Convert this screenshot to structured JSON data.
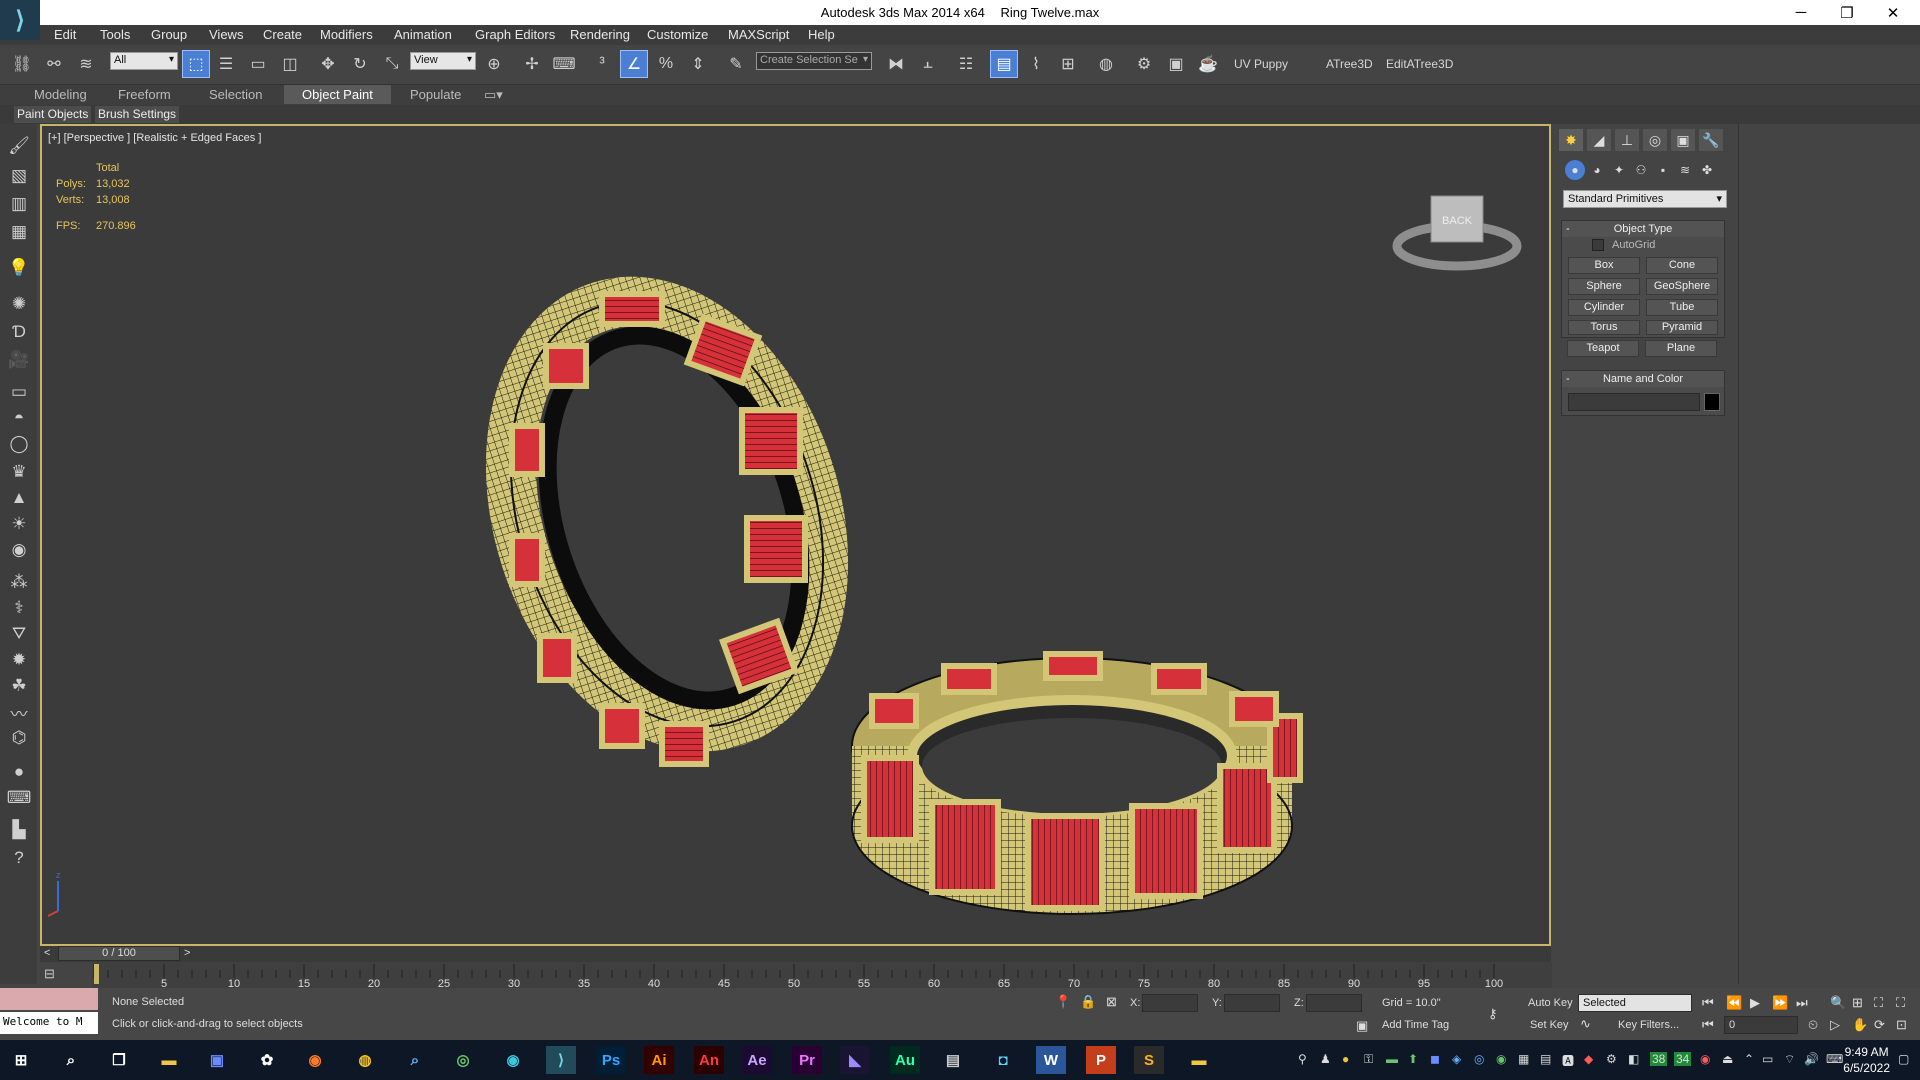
{
  "window": {
    "app_title": "Autodesk 3ds Max  2014 x64",
    "file_name": "Ring Twelve.max"
  },
  "menu": [
    "Edit",
    "Tools",
    "Group",
    "Views",
    "Create",
    "Modifiers",
    "Animation",
    "Graph Editors",
    "Rendering",
    "Customize",
    "MAXScript",
    "Help"
  ],
  "toolbar": {
    "filter_value": "All",
    "ref_coord_value": "View",
    "selection_set_placeholder": "Create Selection Se",
    "uv_puppy": "UV Puppy",
    "atree": "ATree3D",
    "edit_atree": "EditATree3D"
  },
  "ribbon": {
    "tabs": [
      "Modeling",
      "Freeform",
      "Selection",
      "Object Paint",
      "Populate"
    ],
    "active_tab": "Object Paint",
    "sub_tabs": [
      "Paint Objects",
      "Brush Settings"
    ]
  },
  "viewport": {
    "label": "[+] [Perspective ] [Realistic + Edged Faces ]",
    "stats": {
      "header": "Total",
      "polys_label": "Polys:",
      "polys": "13,032",
      "verts_label": "Verts:",
      "verts": "13,008",
      "fps_label": "FPS:",
      "fps": "270.896"
    },
    "viewcube_face": "BACK"
  },
  "command_panel": {
    "category": "Standard Primitives",
    "object_type_title": "Object Type",
    "autogrid_label": "AutoGrid",
    "primitives": [
      "Box",
      "Cone",
      "Sphere",
      "GeoSphere",
      "Cylinder",
      "Tube",
      "Torus",
      "Pyramid",
      "Teapot",
      "Plane"
    ],
    "name_color_title": "Name and Color",
    "name_value": ""
  },
  "timeline": {
    "frame_display": "0 / 100",
    "ticks": [
      "5",
      "10",
      "15",
      "20",
      "25",
      "30",
      "35",
      "40",
      "45",
      "50",
      "55",
      "60",
      "65",
      "70",
      "75",
      "80",
      "85",
      "90",
      "95",
      "100"
    ]
  },
  "status": {
    "maxscript_text": "Welcome to M",
    "selection": "None Selected",
    "prompt": "Click or click-and-drag to select objects",
    "x_label": "X:",
    "y_label": "Y:",
    "z_label": "Z:",
    "grid": "Grid = 10.0\"",
    "add_time_tag": "Add Time Tag",
    "auto_key": "Auto Key",
    "set_key": "Set Key",
    "key_mode": "Selected",
    "key_filters": "Key Filters...",
    "current_frame": "0"
  },
  "taskbar": {
    "time": "9:49 AM",
    "date": "6/5/2022",
    "tray_a": "38",
    "tray_b": "34"
  },
  "colors": {
    "ring_gold": "#d6c97a",
    "ring_red": "#d8323a",
    "active_blue": "#4a7fd4",
    "viewport_border": "#c9b56a"
  }
}
